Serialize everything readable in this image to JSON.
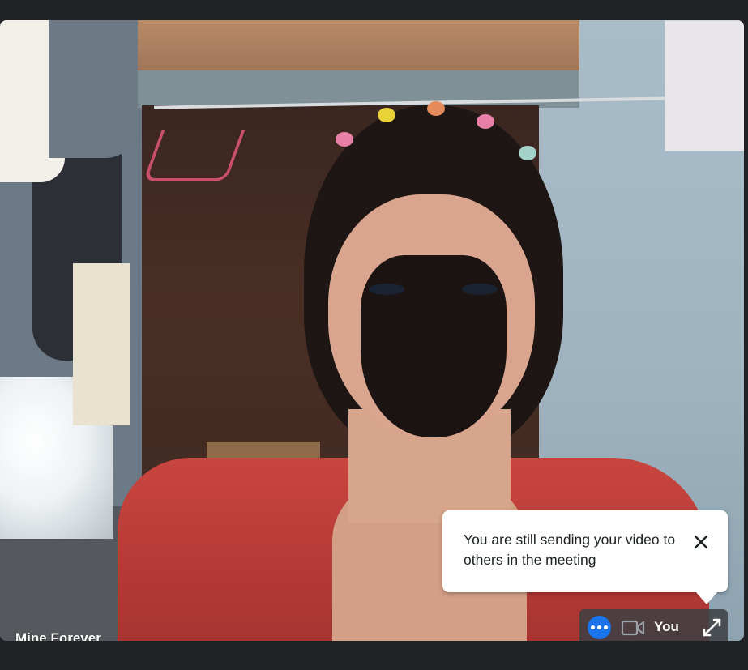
{
  "participant": {
    "name": "Mine Forever"
  },
  "notice": {
    "message": "You are still sending your video to others in the meeting",
    "close_icon": "close-icon"
  },
  "self_view": {
    "label": "You",
    "more_icon": "more-options-icon",
    "camera_icon": "videocam-icon",
    "expand_icon": "expand-icon"
  },
  "colors": {
    "background": "#202124",
    "accent": "#1a73e8",
    "tooltip_bg": "#ffffff",
    "tooltip_text": "#202124"
  }
}
